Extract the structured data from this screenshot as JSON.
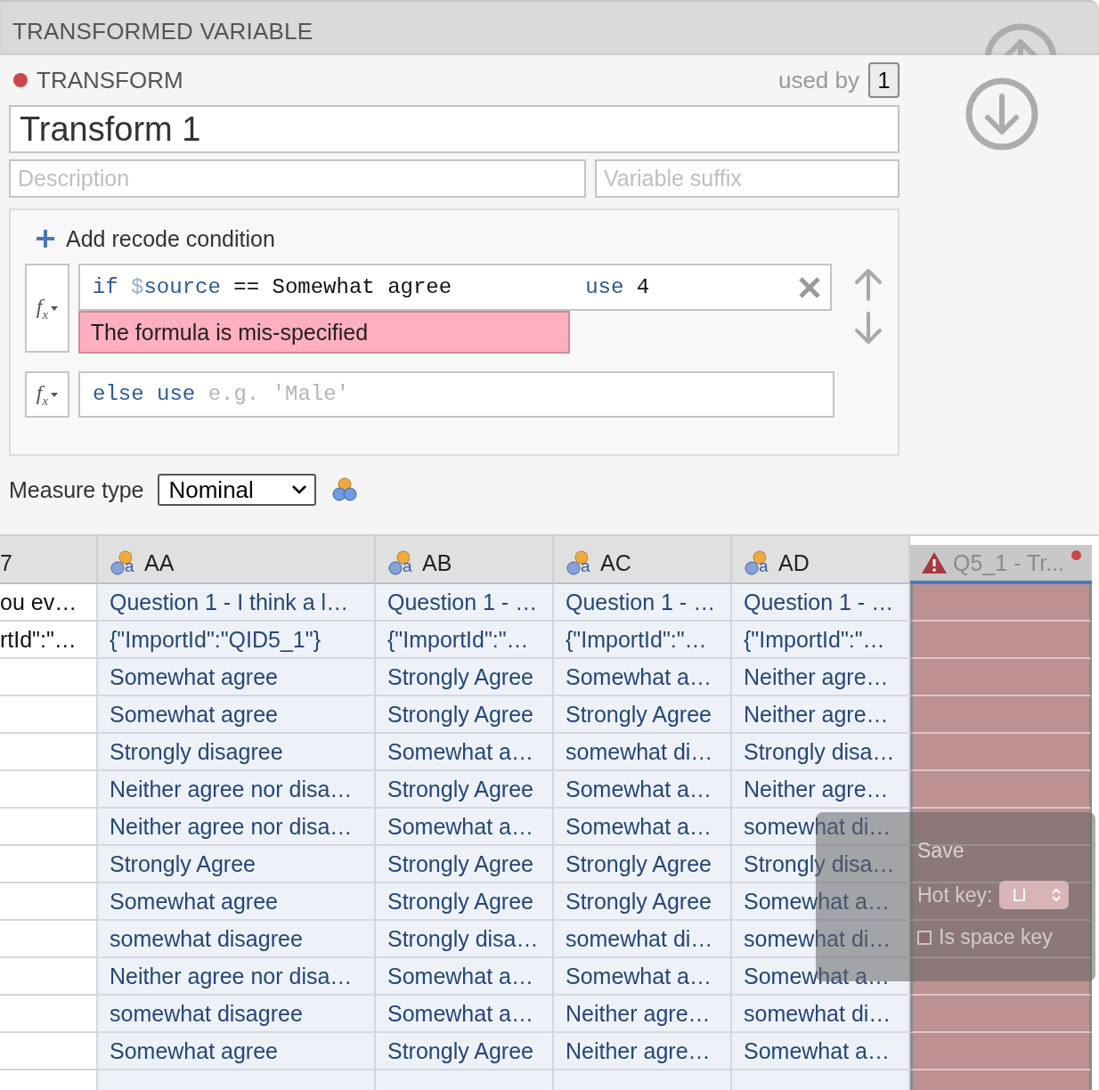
{
  "panel": {
    "title": "TRANSFORMED VARIABLE"
  },
  "transform": {
    "has_error": true,
    "label": "TRANSFORM",
    "used_by_label": "used by",
    "used_by_count": "1",
    "name": "Transform 1",
    "description": {
      "placeholder": "Description"
    },
    "suffix": {
      "placeholder": "Variable suffix"
    }
  },
  "recode": {
    "add_label": "Add recode condition",
    "conditions": [
      {
        "kind": "condition",
        "function_symbol": "f$_{x}$",
        "if_keyword": "if",
        "sigil": "$",
        "variable": "source",
        "expression": "== Somewhat agree",
        "use_keyword": "use",
        "value": "4",
        "error": "The formula is mis-specified"
      }
    ],
    "else_row": {
      "function_symbol": "f$_{x}$",
      "else_keyword": "else",
      "use_keyword": "use",
      "placeholder": "e.g. 'Male'"
    }
  },
  "measure": {
    "label": "Measure type",
    "value": "Nominal"
  },
  "table": {
    "columns": [
      {
        "label": "7",
        "kind": "plain",
        "selected": false,
        "error": false
      },
      {
        "label": "AA",
        "kind": "nominal_text",
        "icon_letter": "a",
        "selected": false,
        "error": false
      },
      {
        "label": "AB",
        "kind": "nominal_text",
        "icon_letter": "a",
        "selected": false,
        "error": false
      },
      {
        "label": "AC",
        "kind": "nominal_text",
        "icon_letter": "a",
        "selected": false,
        "error": false
      },
      {
        "label": "AD",
        "kind": "nominal_text",
        "icon_letter": "a",
        "selected": false,
        "error": false
      },
      {
        "label": "Q5_1 - Tr...",
        "kind": "transform_error",
        "selected": true,
        "error": true
      }
    ],
    "rows": [
      [
        "ou ev…",
        "Question 1 - I think a l…",
        "Question 1 - …",
        "Question 1 - …",
        "Question 1 - …"
      ],
      [
        "rtId\":\"…",
        "{\"ImportId\":\"QID5_1\"}",
        "{\"ImportId\":\"…",
        "{\"ImportId\":\"…",
        "{\"ImportId\":\"…"
      ],
      [
        "",
        "Somewhat agree",
        "Strongly Agree",
        "Somewhat a…",
        "Neither agre…"
      ],
      [
        "",
        "Somewhat agree",
        "Strongly Agree",
        "Strongly Agree",
        "Neither agre…"
      ],
      [
        "",
        "Strongly disagree",
        "Somewhat a…",
        "somewhat di…",
        "Strongly disa…"
      ],
      [
        "",
        "Neither agree nor disa…",
        "Strongly Agree",
        "Somewhat a…",
        "Neither agre…"
      ],
      [
        "",
        "Neither agree nor disa…",
        "Somewhat a…",
        "Somewhat a…",
        "somewhat di…"
      ],
      [
        "",
        "Strongly Agree",
        "Strongly Agree",
        "Strongly Agree",
        "Strongly disa…"
      ],
      [
        "",
        "Somewhat agree",
        "Strongly Agree",
        "Strongly Agree",
        "Somewhat a…"
      ],
      [
        "",
        "somewhat disagree",
        "Strongly disa…",
        "somewhat di…",
        "somewhat di…"
      ],
      [
        "",
        "Neither agree nor disa…",
        "Somewhat a…",
        "Somewhat a…",
        "Somewhat a…"
      ],
      [
        "",
        "somewhat disagree",
        "Somewhat a…",
        "Neither agre…",
        "somewhat di…"
      ],
      [
        "",
        "Somewhat agree",
        "Strongly Agree",
        "Neither agre…",
        "Somewhat a…"
      ],
      [
        "",
        "",
        "",
        "",
        ""
      ]
    ]
  },
  "hud": {
    "title": "Save",
    "hot_key_label": "Hot key:",
    "hot_key_value": "⊔",
    "space_key_label": "Is space key",
    "space_key_checked": false
  }
}
